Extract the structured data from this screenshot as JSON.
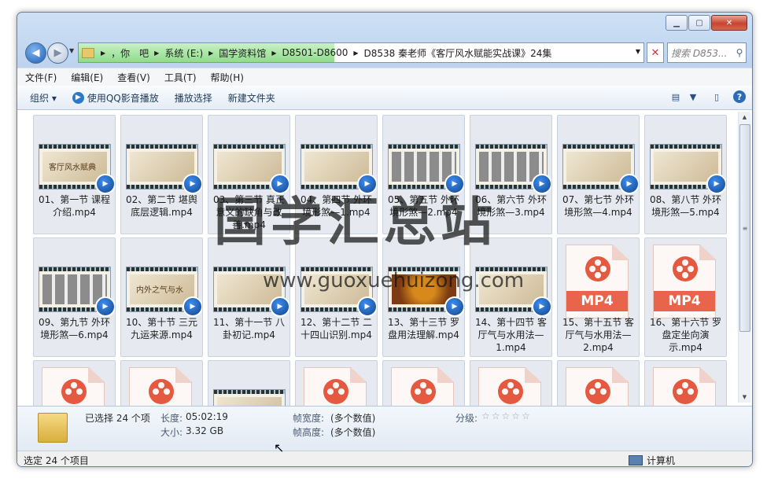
{
  "address": {
    "crumbs": [
      "，你　吧",
      "系统 (E:)",
      "国学资料馆",
      "D8501-D8600",
      "D8538 秦老师《客厅风水赋能实战课》24集"
    ]
  },
  "search": {
    "placeholder": "搜索 D853..."
  },
  "menu": [
    "文件(F)",
    "编辑(E)",
    "查看(V)",
    "工具(T)",
    "帮助(H)"
  ],
  "toolbar": {
    "organize": "组织 ▾",
    "qq_play": "使用QQ影音播放",
    "play_selected": "播放选择",
    "new_folder": "新建文件夹"
  },
  "files": [
    {
      "name": "01、第一节 课程介绍.mp4",
      "thumb": "客厅风水赋典",
      "kind": "video"
    },
    {
      "name": "02、第二节 堪舆底层逻辑.mp4",
      "thumb": "",
      "kind": "video"
    },
    {
      "name": "03、第三节 真正意义的缺角与改善.mp4",
      "thumb": "",
      "kind": "video"
    },
    {
      "name": "04、第四节 外环境形煞—1.mp4",
      "thumb": "",
      "kind": "video"
    },
    {
      "name": "05、第五节 外环境形煞—2.mp4",
      "thumb": "",
      "kind": "photos"
    },
    {
      "name": "06、第六节 外环境形煞—3.mp4",
      "thumb": "",
      "kind": "photos"
    },
    {
      "name": "07、第七节 外环境形煞—4.mp4",
      "thumb": "",
      "kind": "video"
    },
    {
      "name": "08、第八节 外环境形煞—5.mp4",
      "thumb": "",
      "kind": "video"
    },
    {
      "name": "09、第九节 外环境形煞—6.mp4",
      "thumb": "",
      "kind": "photos"
    },
    {
      "name": "10、第十节 三元九运来源.mp4",
      "thumb": "内外之气与水",
      "kind": "video"
    },
    {
      "name": "11、第十一节 八卦初记.mp4",
      "thumb": "",
      "kind": "video"
    },
    {
      "name": "12、第十二节 二十四山识别.mp4",
      "thumb": "",
      "kind": "video"
    },
    {
      "name": "13、第十三节 罗盘用法理解.mp4",
      "thumb": "",
      "kind": "dark"
    },
    {
      "name": "14、第十四节 客厅气与水用法—1.mp4",
      "thumb": "",
      "kind": "video"
    },
    {
      "name": "15、第十五节 客厅气与水用法—2.mp4",
      "thumb": "MP4",
      "kind": "doc"
    },
    {
      "name": "16、第十六节 罗盘定坐向演示.mp4",
      "thumb": "MP4",
      "kind": "doc"
    }
  ],
  "watermark": {
    "title": "国学汇总站",
    "url": "www.guoxuehuizong.com"
  },
  "details": {
    "selected": "已选择 24 个项",
    "length_label": "长度:",
    "length": "05:02:19",
    "size_label": "大小:",
    "size": "3.32 GB",
    "width_label": "帧宽度:",
    "width": "(多个数值)",
    "height_label": "帧高度:",
    "height": "(多个数值)",
    "rating_label": "分级:",
    "rating": "☆☆☆☆☆"
  },
  "status": {
    "left": "选定 24 个项目",
    "right": "计算机"
  }
}
